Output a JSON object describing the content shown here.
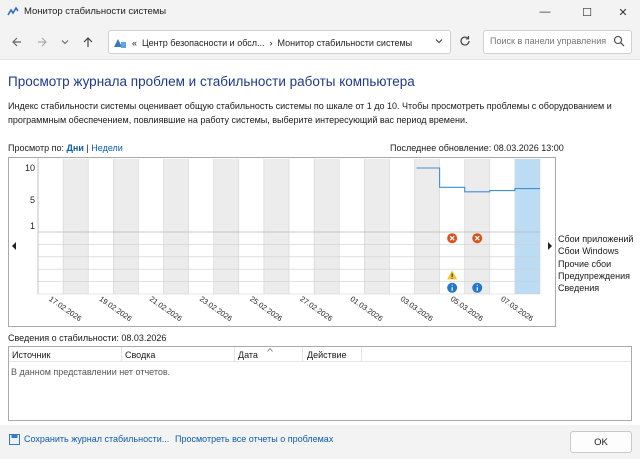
{
  "window": {
    "title": "Монитор стабильности системы",
    "controls": {
      "minimize": "—",
      "maximize": "☐",
      "close": "✕"
    }
  },
  "address_bar": {
    "breadcrumb_prefix": "«",
    "crumb1": "Центр безопасности и обсл...",
    "separator": "›",
    "crumb2": "Монитор стабильности системы",
    "search_placeholder": "Поиск в панели управления"
  },
  "page": {
    "heading": "Просмотр журнала проблем и стабильности работы компьютера",
    "description": "Индекс стабильности системы оценивает общую стабильность системы по шкале от 1 до 10. Чтобы просмотреть проблемы с оборудованием и программным обеспечением, повлиявшие на работу системы, выберите интересующий вас период времени.",
    "view_by_label": "Просмотр по:",
    "view_days": "Дни",
    "view_sep": "|",
    "view_weeks": "Недели",
    "last_update": "Последнее обновление: 08.03.2026 13:00"
  },
  "chart_data": {
    "type": "line",
    "title": "",
    "y_ticks": [
      "10",
      "5",
      "1"
    ],
    "ylim": [
      1,
      10
    ],
    "x_date_labels": [
      "17.02.2026",
      "19.02.2026",
      "21.02.2026",
      "23.02.2026",
      "25.02.2026",
      "27.02.2026",
      "01.03.2026",
      "03.03.2026",
      "05.03.2026",
      "07.03.2026"
    ],
    "day_columns": 20,
    "selected_day_index": 19,
    "stability_index": [
      {
        "day": "04.03.2026",
        "value": 10
      },
      {
        "day": "05.03.2026",
        "value": 7.0
      },
      {
        "day": "06.03.2026",
        "value": 6.3
      },
      {
        "day": "07.03.2026",
        "value": 6.5
      },
      {
        "day": "08.03.2026",
        "value": 6.8
      }
    ],
    "event_rows": [
      "Сбои приложений",
      "Сбои Windows",
      "Прочие сбои",
      "Предупреждения",
      "Сведения"
    ],
    "events": [
      {
        "day": "05.03.2026",
        "row": "Сбои приложений",
        "icon": "error-icon"
      },
      {
        "day": "06.03.2026",
        "row": "Сбои приложений",
        "icon": "error-icon"
      },
      {
        "day": "05.03.2026",
        "row": "Предупреждения",
        "icon": "warning-icon"
      },
      {
        "day": "05.03.2026",
        "row": "Сведения",
        "icon": "info-icon"
      },
      {
        "day": "06.03.2026",
        "row": "Сведения",
        "icon": "info-icon"
      }
    ],
    "colors": {
      "line": "#3f8fd0",
      "selected_column": "#bcdcf4",
      "weekend_column": "#ececec",
      "error": "#d9531e",
      "warning": "#f2c12e",
      "info": "#2378c8"
    }
  },
  "details": {
    "title": "Сведения о стабильности: 08.03.2026",
    "columns": [
      "Источник",
      "Сводка",
      "Дата",
      "Действие"
    ],
    "empty_text": "В данном представлении нет отчетов."
  },
  "footer": {
    "save_link": "Сохранить журнал стабильности...",
    "view_all_link": "Просмотреть все отчеты о проблемах",
    "ok": "OK"
  }
}
